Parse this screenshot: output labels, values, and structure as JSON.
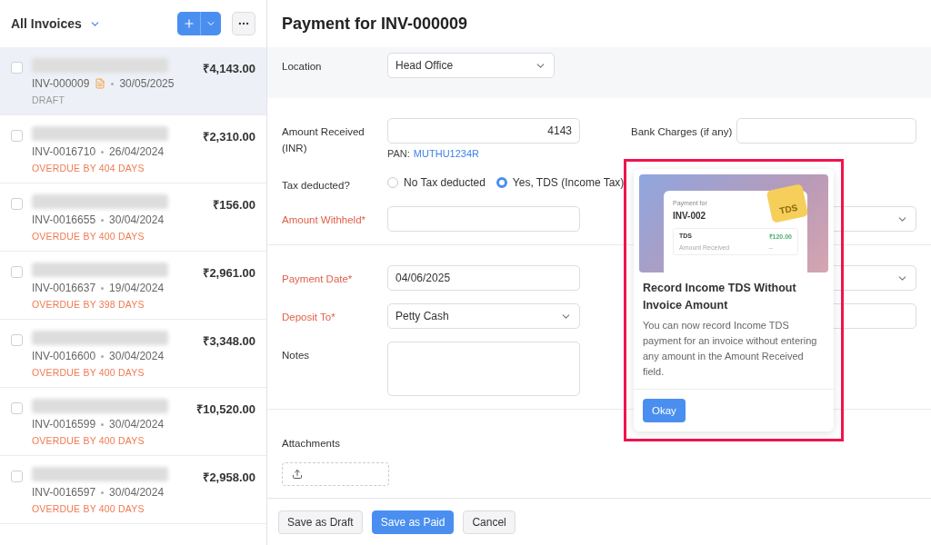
{
  "list_header": {
    "title": "All Invoices"
  },
  "invoices": [
    {
      "number": "INV-000009",
      "date": "30/05/2025",
      "amount": "₹4,143.00",
      "status": "DRAFT",
      "kind": "draft",
      "has_file": true,
      "selected": true,
      "checked": false
    },
    {
      "number": "INV-0016710",
      "date": "26/04/2024",
      "amount": "₹2,310.00",
      "status": "OVERDUE BY 404 DAYS",
      "kind": "overdue",
      "has_file": false,
      "selected": false,
      "checked": false
    },
    {
      "number": "INV-0016655",
      "date": "30/04/2024",
      "amount": "₹156.00",
      "status": "OVERDUE BY 400 DAYS",
      "kind": "overdue",
      "has_file": false,
      "selected": false,
      "checked": false
    },
    {
      "number": "INV-0016637",
      "date": "19/04/2024",
      "amount": "₹2,961.00",
      "status": "OVERDUE BY 398 DAYS",
      "kind": "overdue",
      "has_file": false,
      "selected": false,
      "checked": false
    },
    {
      "number": "INV-0016600",
      "date": "30/04/2024",
      "amount": "₹3,348.00",
      "status": "OVERDUE BY 400 DAYS",
      "kind": "overdue",
      "has_file": false,
      "selected": false,
      "checked": false
    },
    {
      "number": "INV-0016599",
      "date": "30/04/2024",
      "amount": "₹10,520.00",
      "status": "OVERDUE BY 400 DAYS",
      "kind": "overdue",
      "has_file": false,
      "selected": false,
      "checked": false
    },
    {
      "number": "INV-0016597",
      "date": "30/04/2024",
      "amount": "₹2,958.00",
      "status": "OVERDUE BY 400 DAYS",
      "kind": "overdue",
      "has_file": false,
      "selected": false,
      "checked": false
    }
  ],
  "form": {
    "title": "Payment for INV-000009",
    "location": {
      "label": "Location",
      "value": "Head Office"
    },
    "amount_received": {
      "label": "Amount Received (INR)",
      "value": "4143",
      "required": false
    },
    "pan": {
      "label": "PAN:",
      "value": "MUTHU1234R"
    },
    "bank_charges": {
      "label": "Bank Charges (if any)"
    },
    "tax": {
      "label": "Tax deducted?",
      "options": [
        {
          "label": "No Tax deducted",
          "selected": false
        },
        {
          "label": "Yes, TDS (Income Tax)",
          "selected": true
        }
      ]
    },
    "withheld": {
      "label": "Amount Withheld*",
      "required": true
    },
    "payment_date": {
      "label": "Payment Date*",
      "value": "04/06/2025",
      "required": true
    },
    "deposit_to": {
      "label": "Deposit To*",
      "value": "Petty Cash",
      "required": true
    },
    "notes": {
      "label": "Notes"
    },
    "attachments": {
      "label": "Attachments"
    }
  },
  "footer_buttons": [
    {
      "label": "Save as Draft",
      "kind": "secondary"
    },
    {
      "label": "Save as Paid",
      "kind": "primary"
    },
    {
      "label": "Cancel",
      "kind": "secondary"
    }
  ],
  "popover": {
    "illustration": {
      "caption": "Payment for",
      "number": "INV-002",
      "sticker": "TDS",
      "row_label": "TDS",
      "row_value": "₹120.00",
      "row2_label": "Amount Received",
      "row2_value": "--"
    },
    "title": "Record Income TDS Without Invoice Amount",
    "body": "You can now record Income TDS payment for an invoice without entering any amount in the Amount Received field.",
    "button": "Okay"
  }
}
